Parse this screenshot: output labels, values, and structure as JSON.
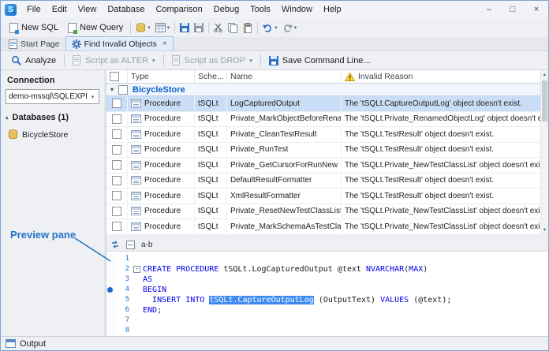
{
  "titlebar": {
    "menus": [
      "File",
      "Edit",
      "View",
      "Database",
      "Comparison",
      "Debug",
      "Tools",
      "Window",
      "Help"
    ]
  },
  "toolbar": {
    "new_sql": "New SQL",
    "new_query": "New Query"
  },
  "tabs": {
    "start_page": "Start Page",
    "find_invalid": "Find Invalid Objects"
  },
  "commandbar": {
    "analyze": "Analyze",
    "script_alter": "Script as ALTER",
    "script_drop": "Script as DROP",
    "save_command_line": "Save Command Line..."
  },
  "sidebar": {
    "connection_label": "Connection",
    "connection_value": "demo-mssql\\SQLEXPRESS",
    "databases_label": "Databases (1)",
    "database": "BicycleStore"
  },
  "grid": {
    "headers": {
      "type": "Type",
      "schema": "Sche...",
      "name": "Name",
      "reason": "Invalid Reason"
    },
    "group_label": "BicycleStore",
    "rows": [
      {
        "type": "Procedure",
        "schema": "tSQLt",
        "name": "LogCapturedOutput",
        "reason": "The 'tSQLt.CaptureOutputLog' object doesn't exist.",
        "selected": true
      },
      {
        "type": "Procedure",
        "schema": "tSQLt",
        "name": "Private_MarkObjectBeforeRename",
        "reason": "The 'tSQLt.Private_RenamedObjectLog' object doesn't exist."
      },
      {
        "type": "Procedure",
        "schema": "tSQLt",
        "name": "Private_CleanTestResult",
        "reason": "The 'tSQLt.TestResult' object doesn't exist."
      },
      {
        "type": "Procedure",
        "schema": "tSQLt",
        "name": "Private_RunTest",
        "reason": "The 'tSQLt.TestResult' object doesn't exist."
      },
      {
        "type": "Procedure",
        "schema": "tSQLt",
        "name": "Private_GetCursorForRunNew",
        "reason": "The 'tSQLt.Private_NewTestClassList' object doesn't exist."
      },
      {
        "type": "Procedure",
        "schema": "tSQLt",
        "name": "DefaultResultFormatter",
        "reason": "The 'tSQLt.TestResult' object doesn't exist."
      },
      {
        "type": "Procedure",
        "schema": "tSQLt",
        "name": "XmlResultFormatter",
        "reason": "The 'tSQLt.TestResult' object doesn't exist."
      },
      {
        "type": "Procedure",
        "schema": "tSQLt",
        "name": "Private_ResetNewTestClassList",
        "reason": "The 'tSQLt.Private_NewTestClassList' object doesn't exist."
      },
      {
        "type": "Procedure",
        "schema": "tSQLt",
        "name": "Private_MarkSchemaAsTestClass",
        "reason": "The 'tSQLt.Private_NewTestClassList' object doesn't exist."
      }
    ]
  },
  "preview": {
    "ab_button": "a-b",
    "code": [
      {
        "n": "1",
        "segs": []
      },
      {
        "n": "2",
        "fold": true,
        "segs": [
          {
            "c": "kw",
            "t": "CREATE PROCEDURE"
          },
          {
            "c": "id",
            "t": " tSQLt.LogCapturedOutput "
          },
          {
            "c": "id",
            "t": "@text "
          },
          {
            "c": "kw",
            "t": "NVARCHAR"
          },
          {
            "c": "id",
            "t": "("
          },
          {
            "c": "kw",
            "t": "MAX"
          },
          {
            "c": "id",
            "t": ")"
          }
        ]
      },
      {
        "n": "3",
        "segs": [
          {
            "c": "kw",
            "t": "AS"
          }
        ]
      },
      {
        "n": "4",
        "marker": true,
        "segs": [
          {
            "c": "kw",
            "t": "BEGIN"
          }
        ]
      },
      {
        "n": "5",
        "segs": [
          {
            "c": "id",
            "t": "  "
          },
          {
            "c": "kw",
            "t": "INSERT INTO"
          },
          {
            "c": "id",
            "t": " "
          },
          {
            "c": "hl",
            "t": "tSQLt.CaptureOutputLog"
          },
          {
            "c": "id",
            "t": " (OutputText) "
          },
          {
            "c": "kw",
            "t": "VALUES"
          },
          {
            "c": "id",
            "t": " (@text);"
          }
        ]
      },
      {
        "n": "6",
        "segs": [
          {
            "c": "kw",
            "t": "END"
          },
          {
            "c": "id",
            "t": ";"
          }
        ]
      },
      {
        "n": "7",
        "segs": []
      },
      {
        "n": "8",
        "segs": []
      }
    ]
  },
  "annotation": {
    "label": "Preview pane"
  },
  "output": {
    "label": "Output"
  },
  "icons": {
    "app_logo_letter": "S",
    "dropdown": "▾",
    "collapse": "▴",
    "expand": "▾",
    "minimize": "–",
    "maximize": "□",
    "close": "×",
    "close_tab": "×",
    "scroll_up": "▲",
    "scroll_down": "▼",
    "fold_collapse": "-"
  },
  "colors": {
    "accent_blue": "#1b6fd0",
    "selection_row": "#c9def6",
    "keyword_blue": "#0000e6",
    "highlight_token": "#3d8af0",
    "annotation_blue": "#2472c8",
    "warning_yellow": "#ffd83d"
  }
}
